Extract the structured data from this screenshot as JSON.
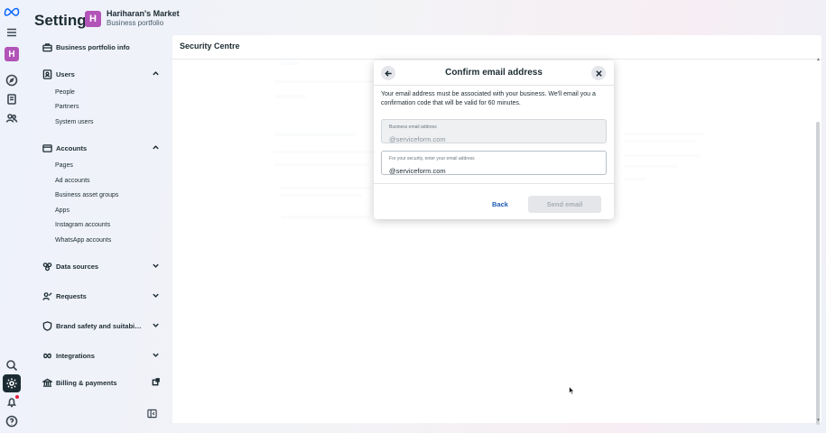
{
  "app": {
    "title": "Settings",
    "portfolio_name": "Hariharan's Market",
    "portfolio_type": "Business portfolio",
    "portfolio_initial": "H"
  },
  "rail": {
    "meta_logo": "meta-logo",
    "icons": [
      "menu-icon",
      "portfolio-avatar",
      "compass-icon",
      "pages-icon",
      "users-icon",
      "search-icon",
      "gear-icon",
      "bell-icon",
      "help-icon"
    ]
  },
  "sidebar": {
    "business_info": "Business portfolio info",
    "users": {
      "label": "Users",
      "items": [
        "People",
        "Partners",
        "System users"
      ]
    },
    "accounts": {
      "label": "Accounts",
      "items": [
        "Pages",
        "Ad accounts",
        "Business asset groups",
        "Apps",
        "Instagram accounts",
        "WhatsApp accounts"
      ]
    },
    "data_sources": "Data sources",
    "requests": "Requests",
    "brand_safety": "Brand safety and suitabi…",
    "integrations": "Integrations",
    "billing": "Billing & payments"
  },
  "main": {
    "title": "Security Centre"
  },
  "modal": {
    "title": "Confirm email address",
    "description": "Your email address must be associated with your business. We'll email you a confirmation code that will be valid for 60 minutes.",
    "business_email_label": "Business email address",
    "business_email_value": "@serviceform.com",
    "security_label": "For your security, enter your email address",
    "security_value": "@serviceform.com",
    "back_label": "Back",
    "send_label": "Send email"
  }
}
